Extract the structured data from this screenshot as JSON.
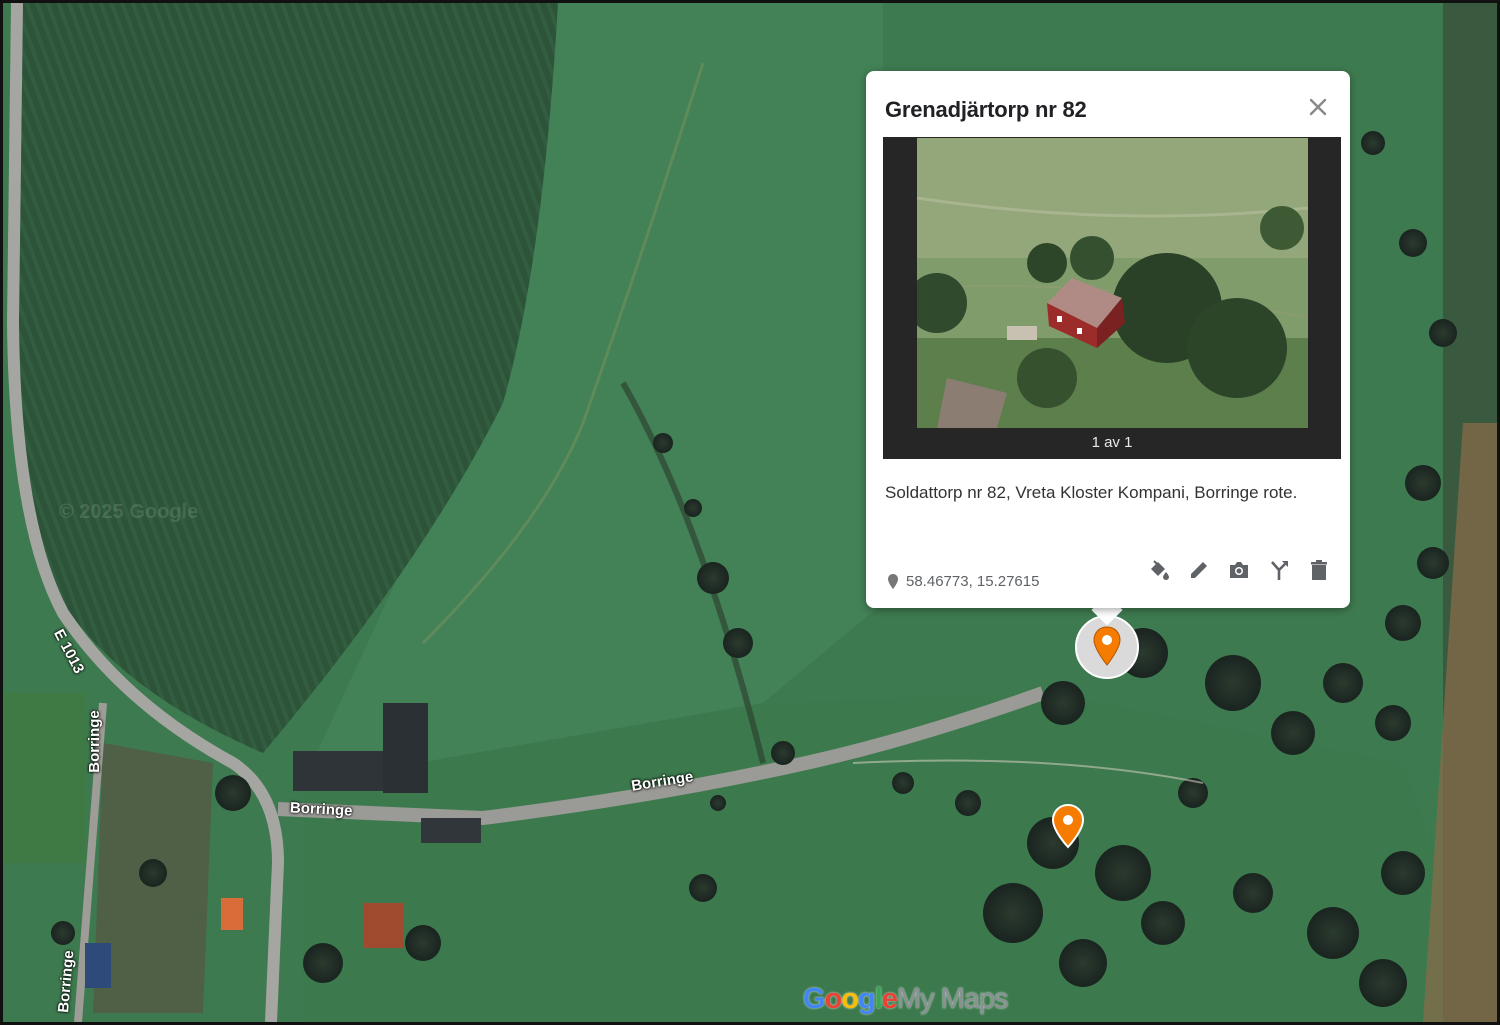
{
  "map": {
    "roads": [
      {
        "name": "E 1013"
      },
      {
        "name": "Borringe"
      },
      {
        "name": "Borringe"
      },
      {
        "name": "Borringe"
      },
      {
        "name": "Borringe"
      }
    ],
    "brand": {
      "google": "Google",
      "mymaps": "My Maps"
    },
    "colors": {
      "marker": "#f57c00",
      "field": "#2f5a3c",
      "grass": "#3f7a4e",
      "road": "#9a9a96"
    }
  },
  "popup": {
    "title": "Grenadjärtorp nr 82",
    "photo_counter": "1 av 1",
    "description": "Soldattorp nr 82, Vreta Kloster Kompani, Borringe rote.",
    "coordinates": "58.46773, 15.27615",
    "actions": [
      {
        "icon": "paint-bucket-icon"
      },
      {
        "icon": "pencil-icon"
      },
      {
        "icon": "camera-icon"
      },
      {
        "icon": "directions-fork-icon"
      },
      {
        "icon": "trash-icon"
      }
    ]
  }
}
